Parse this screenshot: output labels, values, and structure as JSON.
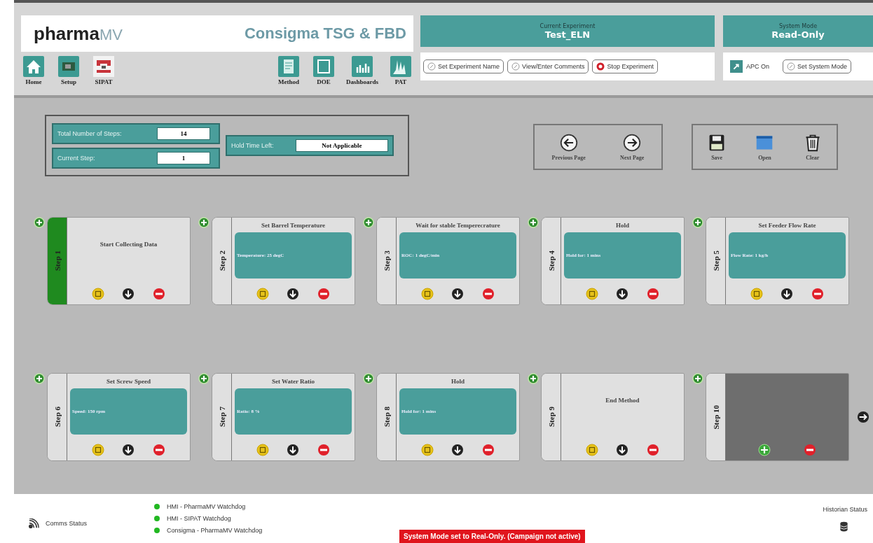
{
  "header": {
    "logo_main": "pharma",
    "logo_suffix": "MV",
    "title": "Consigma TSG & FBD"
  },
  "nav_left": [
    {
      "label": "Home",
      "kind": "home"
    },
    {
      "label": "Setup",
      "kind": "setup"
    },
    {
      "label": "SIPAT",
      "kind": "sipat"
    }
  ],
  "nav_right": [
    {
      "label": "Method",
      "kind": "method"
    },
    {
      "label": "DOE",
      "kind": "doe"
    },
    {
      "label": "Dashboards",
      "kind": "dash"
    },
    {
      "label": "PAT",
      "kind": "pat"
    }
  ],
  "experiment": {
    "caption": "Current Experiment",
    "value": "Test_ELN",
    "buttons": [
      {
        "label": "Set Experiment Name",
        "kind": "edit"
      },
      {
        "label": "View/Enter Comments",
        "kind": "edit"
      },
      {
        "label": "Stop Experiment",
        "kind": "stop"
      }
    ]
  },
  "system_mode": {
    "caption": "System Mode",
    "value": "Read-Only",
    "apc_label": "APC On",
    "button": "Set System Mode"
  },
  "steps_info": {
    "total_label": "Total Number of Steps:",
    "total": "14",
    "current_label": "Current Step:",
    "current": "1",
    "hold_label": "Hold Time Left:",
    "hold": "Not Applicable"
  },
  "pager": [
    {
      "label": "Previous Page",
      "kind": "prev"
    },
    {
      "label": "Next Page",
      "kind": "next"
    }
  ],
  "file_actions": [
    {
      "label": "Save",
      "kind": "save"
    },
    {
      "label": "Open",
      "kind": "open"
    },
    {
      "label": "Clear",
      "kind": "clear"
    }
  ],
  "steps": [
    {
      "label": "Step 1",
      "kind": "plain",
      "title": "Start Collecting Data",
      "selected": true
    },
    {
      "label": "Step 2",
      "kind": "param",
      "title": "Set Barrel Temperature",
      "param": "Temperature: 25 degC",
      "selected": false
    },
    {
      "label": "Step 3",
      "kind": "param",
      "title": "Wait for stable Temperecrature",
      "param": "ROC: 1 degC/min",
      "selected": false
    },
    {
      "label": "Step 4",
      "kind": "param",
      "title": "Hold",
      "param": "Hold for: 1 mins",
      "selected": false
    },
    {
      "label": "Step 5",
      "kind": "param",
      "title": "Set Feeder Flow Rate",
      "param": "Flow Rate: 1 kg/h",
      "selected": false
    },
    {
      "label": "Step 6",
      "kind": "param",
      "title": "Set Screw Speed",
      "param": "Speed: 150 rpm",
      "selected": false
    },
    {
      "label": "Step 7",
      "kind": "param",
      "title": "Set Water Ratio",
      "param": "Ratio: 8 %",
      "selected": false
    },
    {
      "label": "Step 8",
      "kind": "param",
      "title": "Hold",
      "param": "Hold for: 1 mins",
      "selected": false
    },
    {
      "label": "Step 9",
      "kind": "plain",
      "title": "End Method",
      "selected": false
    },
    {
      "label": "Step 10",
      "kind": "empty",
      "selected": false
    }
  ],
  "status": {
    "comms": "Comms Status",
    "watchdogs": [
      {
        "label": "HMI - PharmaMV Watchdog",
        "color": "#22b822"
      },
      {
        "label": "HMI - SIPAT Watchdog",
        "color": "#22b822"
      },
      {
        "label": "Consigma - PharmaMV Watchdog",
        "color": "#22b822"
      }
    ],
    "message": "System Mode set to Real-Only. (Campaign not active)",
    "historian": "Historian Status"
  }
}
